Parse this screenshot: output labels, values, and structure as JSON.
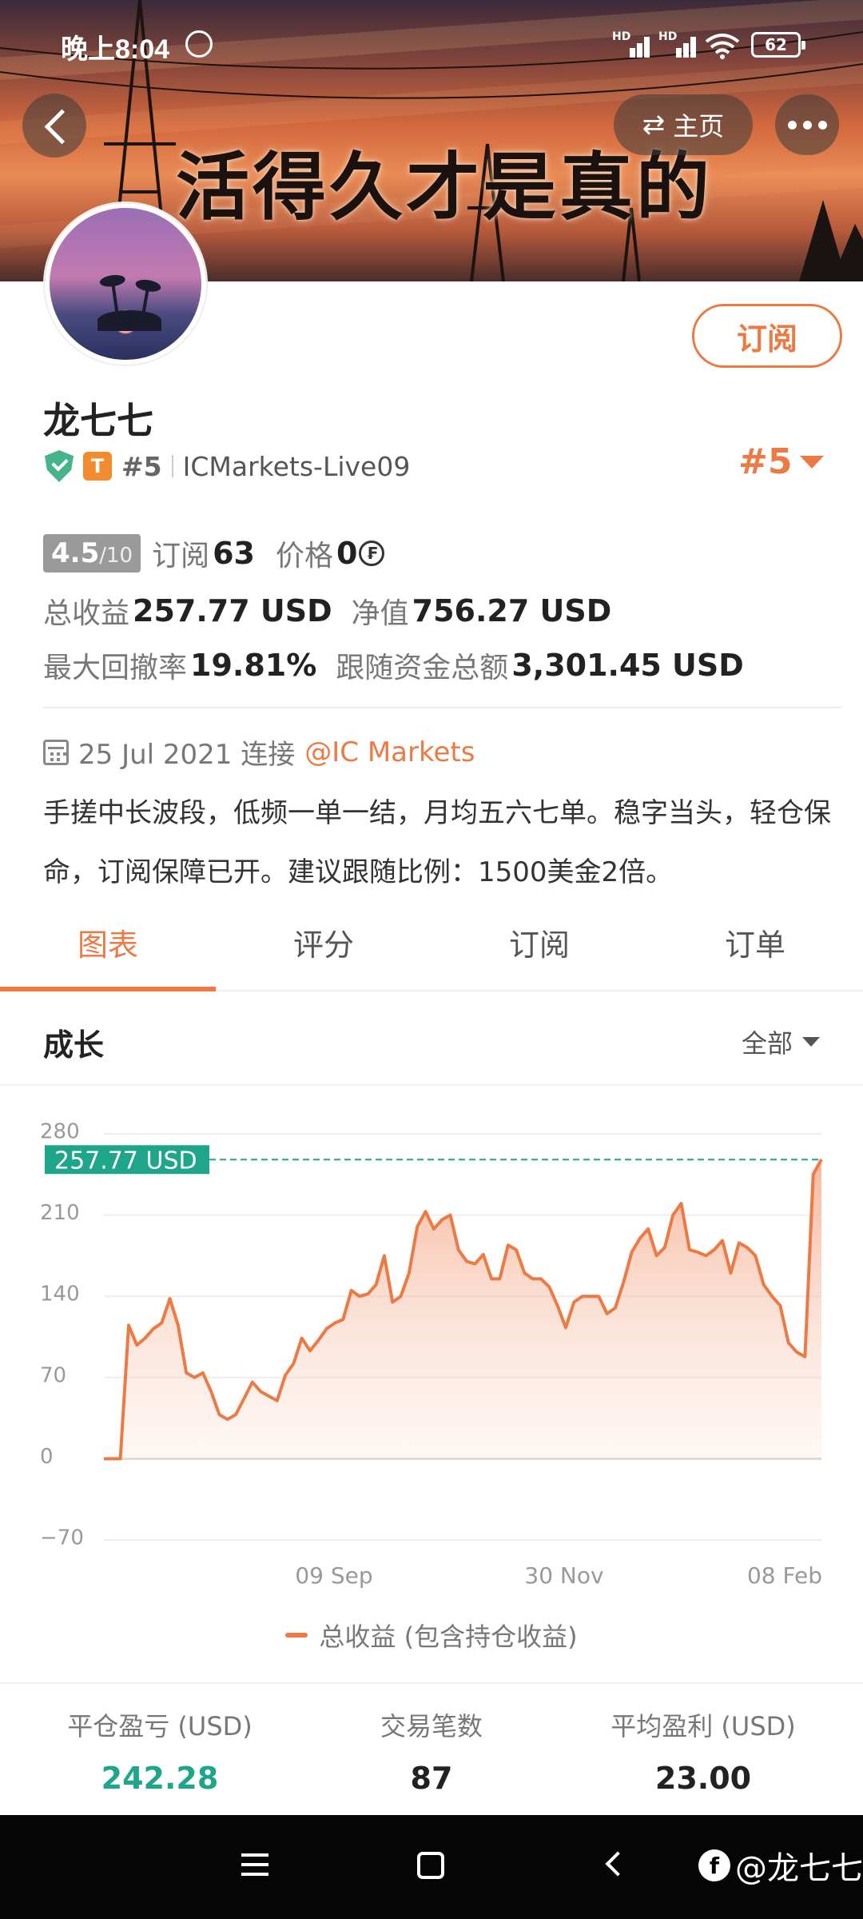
{
  "status_bar": {
    "time": "晚上8:04",
    "battery": "62",
    "hd1": "HD",
    "hd2": "HD"
  },
  "header": {
    "banner_slogan": "活得久才是真的",
    "home_label": "主页"
  },
  "profile": {
    "name": "龙七七",
    "rank_small": "#5",
    "broker_account": "ICMarkets-Live09",
    "rank_big": "#5",
    "subscribe_label": "订阅",
    "tier_badge": "T"
  },
  "stats": {
    "score": "4.5",
    "score_max": "/10",
    "subscriptions_label": "订阅",
    "subscriptions": "63",
    "price_label": "价格",
    "price": "0",
    "total_profit_label": "总收益",
    "total_profit": "257.77 USD",
    "equity_label": "净值",
    "equity": "756.27 USD",
    "max_drawdown_label": "最大回撤率",
    "max_drawdown": "19.81%",
    "follow_funds_label": "跟随资金总额",
    "follow_funds": "3,301.45 USD"
  },
  "info": {
    "joined": "25 Jul 2021 连接",
    "broker_link": "@IC Markets",
    "description": "手搓中长波段，低频一单一结，月均五六七单。稳字当头，轻仓保命，订阅保障已开。建议跟随比例：1500美金2倍。"
  },
  "tabs": [
    {
      "label": "图表",
      "active": true
    },
    {
      "label": "评分",
      "active": false
    },
    {
      "label": "订阅",
      "active": false
    },
    {
      "label": "订单",
      "active": false
    }
  ],
  "section": {
    "title": "成长",
    "range": "全部"
  },
  "chart_data": {
    "type": "area",
    "series": [
      {
        "name": "总收益 (包含持仓收益)",
        "color": "#ec7a45",
        "values": [
          0,
          0,
          0,
          115,
          98,
          104,
          112,
          117,
          138,
          115,
          74,
          70,
          74,
          58,
          38,
          34,
          38,
          52,
          66,
          58,
          54,
          50,
          72,
          82,
          104,
          93,
          102,
          112,
          117,
          120,
          145,
          140,
          142,
          150,
          175,
          135,
          140,
          160,
          200,
          213,
          198,
          206,
          210,
          180,
          170,
          168,
          176,
          155,
          155,
          184,
          180,
          160,
          155,
          155,
          148,
          132,
          113,
          135,
          140,
          140,
          140,
          125,
          130,
          152,
          178,
          190,
          198,
          175,
          182,
          210,
          220,
          180,
          178,
          175,
          180,
          188,
          160,
          186,
          182,
          175,
          150,
          140,
          132,
          100,
          92,
          88,
          245,
          258
        ]
      }
    ],
    "x_ticks": [
      "09 Sep",
      "30 Nov",
      "08 Feb"
    ],
    "y_ticks": [
      280,
      210,
      140,
      70,
      0,
      -70
    ],
    "ylim": [
      -70,
      280
    ],
    "last_value_label": "257.77 USD",
    "last_value": 257.77,
    "grid": true
  },
  "legend": {
    "label": "总收益 (包含持仓收益)"
  },
  "summary": [
    {
      "label": "平仓盈亏 (USD)",
      "value": "242.28",
      "color": "green"
    },
    {
      "label": "交易笔数",
      "value": "87",
      "color": "default"
    },
    {
      "label": "平均盈利 (USD)",
      "value": "23.00",
      "color": "default"
    }
  ],
  "watermark": {
    "text": "@龙七七"
  }
}
